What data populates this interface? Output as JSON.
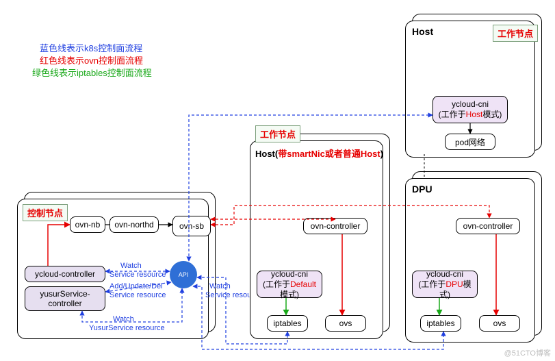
{
  "legend": {
    "blue": "蓝色线表示k8s控制面流程",
    "red": "红色线表示ovn控制面流程",
    "green": "绿色线表示iptables控制面流程"
  },
  "tags": {
    "control": "控制节点",
    "worker": "工作节点"
  },
  "control_panel": {
    "ovn_nb": "ovn-nb",
    "ovn_northd": "ovn-northd",
    "ovn_sb": "ovn-sb",
    "ycloud_controller": "ycloud-controller",
    "yusur_svc_controller": "yusurService-controller",
    "k8s_api": "API"
  },
  "labels": {
    "watch": "Watch",
    "svc_res": "Service resource",
    "aud": "Add/Update/Del",
    "yusur_res": "YusurService resource"
  },
  "middle": {
    "title_pre": "Host(",
    "title_red": "带smartNic或者普通Host",
    "title_post": ")",
    "ovn_ctrl": "ovn-controller",
    "cni_pre": "ycloud-cni",
    "cni_mode_pre": "(工作于",
    "cni_mode": "Default",
    "cni_mode_post": "模式)",
    "iptables": "iptables",
    "ovs": "ovs"
  },
  "right_top": {
    "title": "Host",
    "cni_pre": "ycloud-cni",
    "cni_mode_pre": "(工作于",
    "cni_mode": "Host",
    "cni_mode_post": "模式)",
    "pod_net": "pod网络"
  },
  "right_bottom": {
    "title": "DPU",
    "ovn_ctrl": "ovn-controller",
    "cni_pre": "ycloud-cni",
    "cni_mode_pre": "(工作于",
    "cni_mode": "DPU",
    "cni_mode_post": "模式)",
    "iptables": "iptables",
    "ovs": "ovs"
  },
  "watermark": "@51CTO博客"
}
